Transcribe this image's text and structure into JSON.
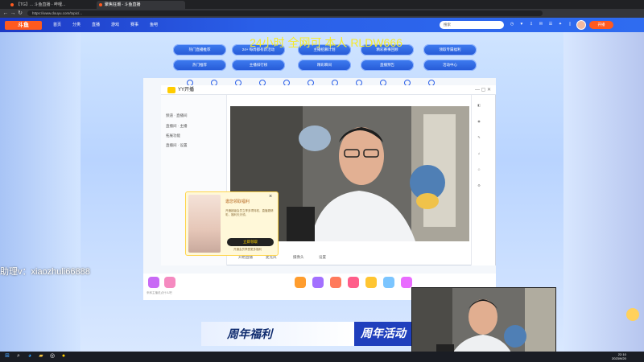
{
  "browser": {
    "tabs": [
      {
        "label": "【TG】... 斗鱼直播 - 哔哩..."
      },
      {
        "label": "聚焦狂潮 - 斗鱼直播"
      }
    ],
    "url": "https://www.douyu.com/topic/..."
  },
  "site": {
    "logo": "斗鱼",
    "nav": [
      "首页",
      "分类",
      "直播",
      "游戏",
      "赛事",
      "鱼吧"
    ],
    "search_placeholder": "搜索",
    "start_live": "开播"
  },
  "overlay_text": "24小时 全网可 本人 RLDW666",
  "banner_row1": [
    "热门直播推荐",
    "24+ 每周都有新活动",
    "主播招募计划",
    "精彩赛事回顾",
    "领取专属福利"
  ],
  "banner_row2": [
    "热门推荐",
    "主播排行榜",
    "精彩瞬间",
    "直播预告",
    "活动中心"
  ],
  "yy": {
    "app_name": "YY开播",
    "sidebar": [
      "频道 · 直播间",
      "直播间 · 主播",
      "拓展功能",
      "直播间 · 设置"
    ],
    "controls": [
      "开始直播",
      "麦克风",
      "摄像头",
      "设置"
    ]
  },
  "popup": {
    "title": "邀您领取福利",
    "text": "开通超级会员立享多项特权，直播更精彩，福利天天领。",
    "button": "立即领取",
    "footer": "开通会员享受更多福利"
  },
  "chat_hint": "来和主播说点什么吧",
  "contact": "助理v：xiaozhuli66888",
  "anniversary": "周年福利",
  "event": "周年活动",
  "clock": {
    "time": "22:10",
    "date": "2023/9/20"
  }
}
